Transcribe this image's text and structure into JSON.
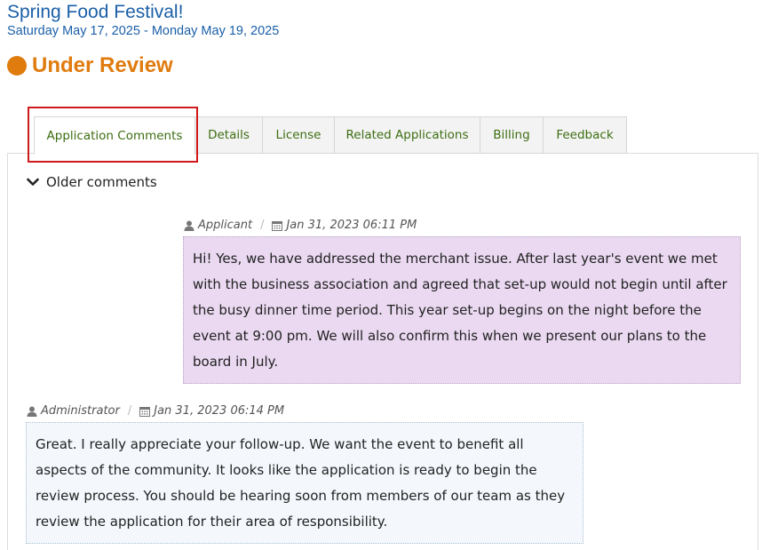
{
  "event": {
    "title": "Spring Food Festival!",
    "dates": "Saturday May 17, 2025 - Monday May 19, 2025"
  },
  "status": {
    "label": "Under Review",
    "color": "#e07b0e"
  },
  "tabs": [
    {
      "label": "Application Comments",
      "active": true
    },
    {
      "label": "Details",
      "active": false
    },
    {
      "label": "License",
      "active": false
    },
    {
      "label": "Related Applications",
      "active": false
    },
    {
      "label": "Billing",
      "active": false
    },
    {
      "label": "Feedback",
      "active": false
    }
  ],
  "older_comments": {
    "label": "Older comments",
    "icon": "chevron-down-icon"
  },
  "comments": [
    {
      "author": "Applicant",
      "timestamp": "Jan 31, 2023 06:11 PM",
      "author_icon": "user-icon",
      "date_icon": "calendar-icon",
      "text": "Hi! Yes, we have addressed the merchant issue. After last year's event we met with the business association and agreed that set-up would not begin until after the busy dinner time period. This year set-up begins on the night before the event at 9:00 pm. We will also confirm this when we present our plans to the board in July."
    },
    {
      "author": "Administrator",
      "timestamp": "Jan 31, 2023 06:14 PM",
      "author_icon": "user-icon",
      "date_icon": "calendar-icon",
      "text": "Great. I really appreciate your follow-up. We want the event to benefit all aspects of the community. It looks like the application is ready to begin the review process. You should be hearing soon from members of our team as they review the application for their area of responsibility."
    }
  ]
}
